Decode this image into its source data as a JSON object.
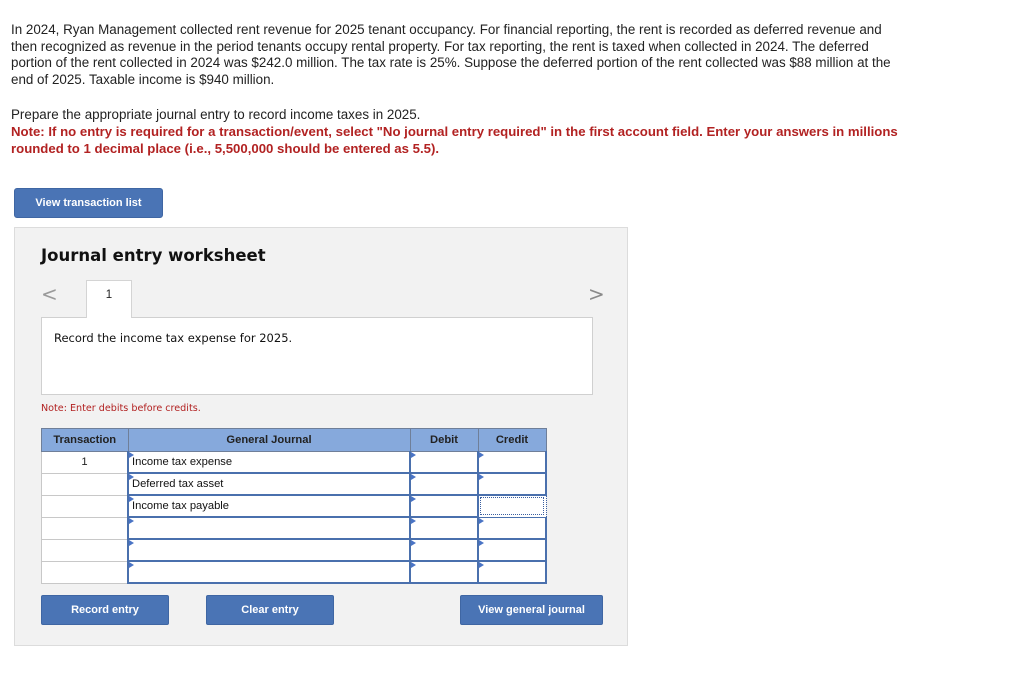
{
  "problem": {
    "text": "In 2024, Ryan Management collected rent revenue for 2025 tenant occupancy. For financial reporting, the rent is recorded as deferred revenue and then recognized as revenue in the period tenants occupy rental property. For tax reporting, the rent is taxed when collected in 2024. The deferred portion of the rent collected in 2024 was $242.0 million. The tax rate is 25%. Suppose the deferred portion of the rent collected was $88 million at the end of 2025. Taxable income is $940 million.",
    "instruction": "Prepare the appropriate journal entry to record income taxes in 2025.",
    "note": "Note: If no entry is required for a transaction/event, select \"No journal entry required\" in the first account field. Enter your answers in millions rounded to 1 decimal place (i.e., 5,500,000 should be entered as 5.5)."
  },
  "buttons": {
    "view_transaction_list": "View transaction list",
    "record_entry": "Record entry",
    "clear_entry": "Clear entry",
    "view_general_journal": "View general journal"
  },
  "worksheet": {
    "title": "Journal entry worksheet",
    "prev_icon": "<",
    "next_icon": ">",
    "tab_label": "1",
    "description": "Record the income tax expense for 2025.",
    "debit_note": "Note: Enter debits before credits.",
    "columns": [
      "Transaction",
      "General Journal",
      "Debit",
      "Credit"
    ],
    "rows": [
      {
        "transaction": "1",
        "account": "Income tax expense",
        "debit": "",
        "credit": ""
      },
      {
        "transaction": "",
        "account": "Deferred tax asset",
        "debit": "",
        "credit": ""
      },
      {
        "transaction": "",
        "account": "Income tax payable",
        "debit": "",
        "credit": ""
      },
      {
        "transaction": "",
        "account": "",
        "debit": "",
        "credit": ""
      },
      {
        "transaction": "",
        "account": "",
        "debit": "",
        "credit": ""
      },
      {
        "transaction": "",
        "account": "",
        "debit": "",
        "credit": ""
      }
    ]
  }
}
